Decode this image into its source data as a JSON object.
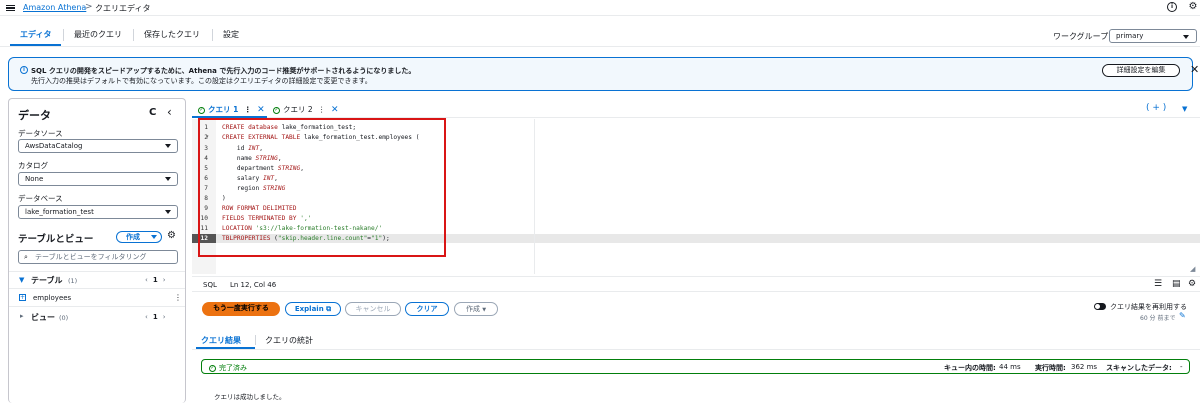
{
  "nav": {
    "breadcrumb_link": "Amazon Athena",
    "breadcrumb_sep": ">",
    "breadcrumb_current": "クエリエディタ",
    "info_icon_glyph": "i",
    "settings_icon_glyph": "⚙"
  },
  "tabs": [
    {
      "label": "エディタ",
      "active": true
    },
    {
      "label": "最近のクエリ",
      "active": false
    },
    {
      "label": "保存したクエリ",
      "active": false
    },
    {
      "label": "設定",
      "active": false
    }
  ],
  "workgroup": {
    "label": "ワークグループ",
    "value": "primary"
  },
  "banner": {
    "title": "SQL クエリの開発をスピードアップするために、Athena で先行入力のコード推奨がサポートされるようになりました。",
    "text": "先行入力の推奨はデフォルトで有効になっています。この設定はクエリエディタの詳細設定で変更できます。",
    "button": "詳細設定を編集",
    "close": "✕",
    "accent": "#0972d3"
  },
  "data_panel": {
    "title": "データ",
    "refresh": "C",
    "collapse": "‹",
    "datasource_label": "データソース",
    "datasource_value": "AwsDataCatalog",
    "catalog_label": "カタログ",
    "catalog_value": "None",
    "database_label": "データベース",
    "database_value": "lake_formation_test",
    "tables_views_title": "テーブルとビュー",
    "create_button": "作成",
    "filter_placeholder": "テーブルとビューをフィルタリング",
    "tables_header": "テーブル",
    "tables_count": "(1)",
    "tables_page": "1",
    "tables": [
      "employees"
    ],
    "views_header": "ビュー",
    "views_count": "(0)",
    "views_page": "1",
    "pager_prev": "‹",
    "pager_next": "›"
  },
  "query_tabs": [
    {
      "label": "クエリ 1",
      "active": true
    },
    {
      "label": "クエリ 2",
      "active": false
    }
  ],
  "query_tabs_more": "⋮",
  "query_tabs_close": "✕",
  "query_tabs_add": "( + )",
  "editor": {
    "line_numbers": [
      "1",
      "2",
      "3",
      "4",
      "5",
      "6",
      "7",
      "8",
      "9",
      "10",
      "11",
      "12"
    ],
    "current_line": "12"
  },
  "status": {
    "language": "SQL",
    "position": "Ln 12, Col 46"
  },
  "actions": {
    "run_again": "もう一度実行する",
    "explain": "Explain",
    "cancel": "キャンセル",
    "clear": "クリア",
    "create": "作成",
    "reuse_label": "クエリ結果を再利用する",
    "reuse_sub": "60 分 前まで",
    "run_color": "#ec7211"
  },
  "results": {
    "tab_results": "クエリ結果",
    "tab_stats": "クエリの統計",
    "status": "完了済み",
    "queue_label": "キュー内の時間:",
    "queue_value": "44 ms",
    "exec_label": "実行時間:",
    "exec_value": "362 ms",
    "scan_label": "スキャンしたデータ:",
    "scan_value": "-",
    "message": "クエリは成功しました。",
    "ok_color": "#037f0c"
  }
}
